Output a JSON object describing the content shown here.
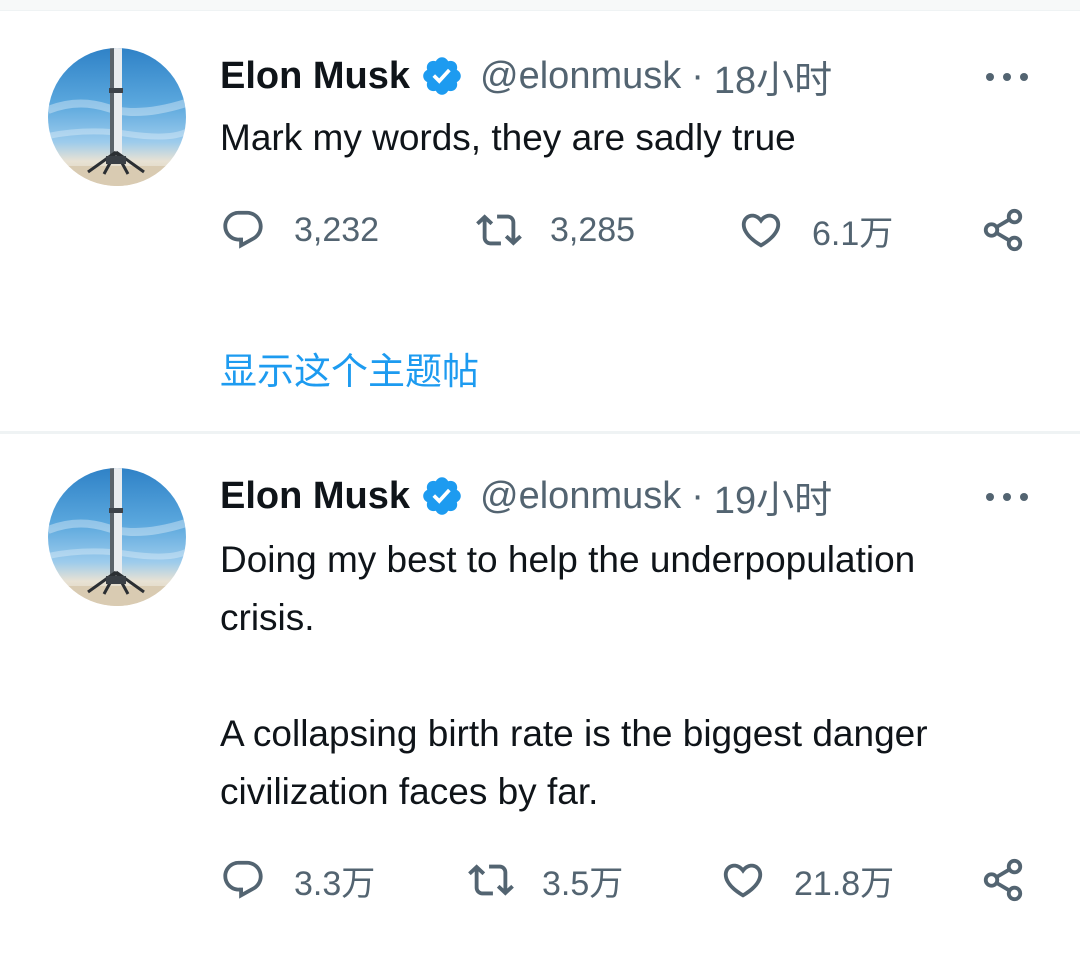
{
  "colors": {
    "accent": "#1d9bf0",
    "text_primary": "#0f1419",
    "text_secondary": "#536471",
    "divider": "#eff3f4"
  },
  "tweets": [
    {
      "author_name": "Elon Musk",
      "verified_icon": "verified-badge-icon",
      "handle": "@elonmusk",
      "separator": "·",
      "time": "18小时",
      "text_lines": [
        "Mark my words, they are sadly true"
      ],
      "reply_count": "3,232",
      "retweet_count": "3,285",
      "like_count": "6.1万",
      "show_thread_label": "显示这个主题帖"
    },
    {
      "author_name": "Elon Musk",
      "verified_icon": "verified-badge-icon",
      "handle": "@elonmusk",
      "separator": "·",
      "time": "19小时",
      "text_lines": [
        "Doing my best to help the underpopulation",
        "crisis.",
        "A collapsing birth rate is the biggest danger",
        "civilization faces by far."
      ],
      "reply_count": "3.3万",
      "retweet_count": "3.5万",
      "like_count": "21.8万"
    }
  ]
}
